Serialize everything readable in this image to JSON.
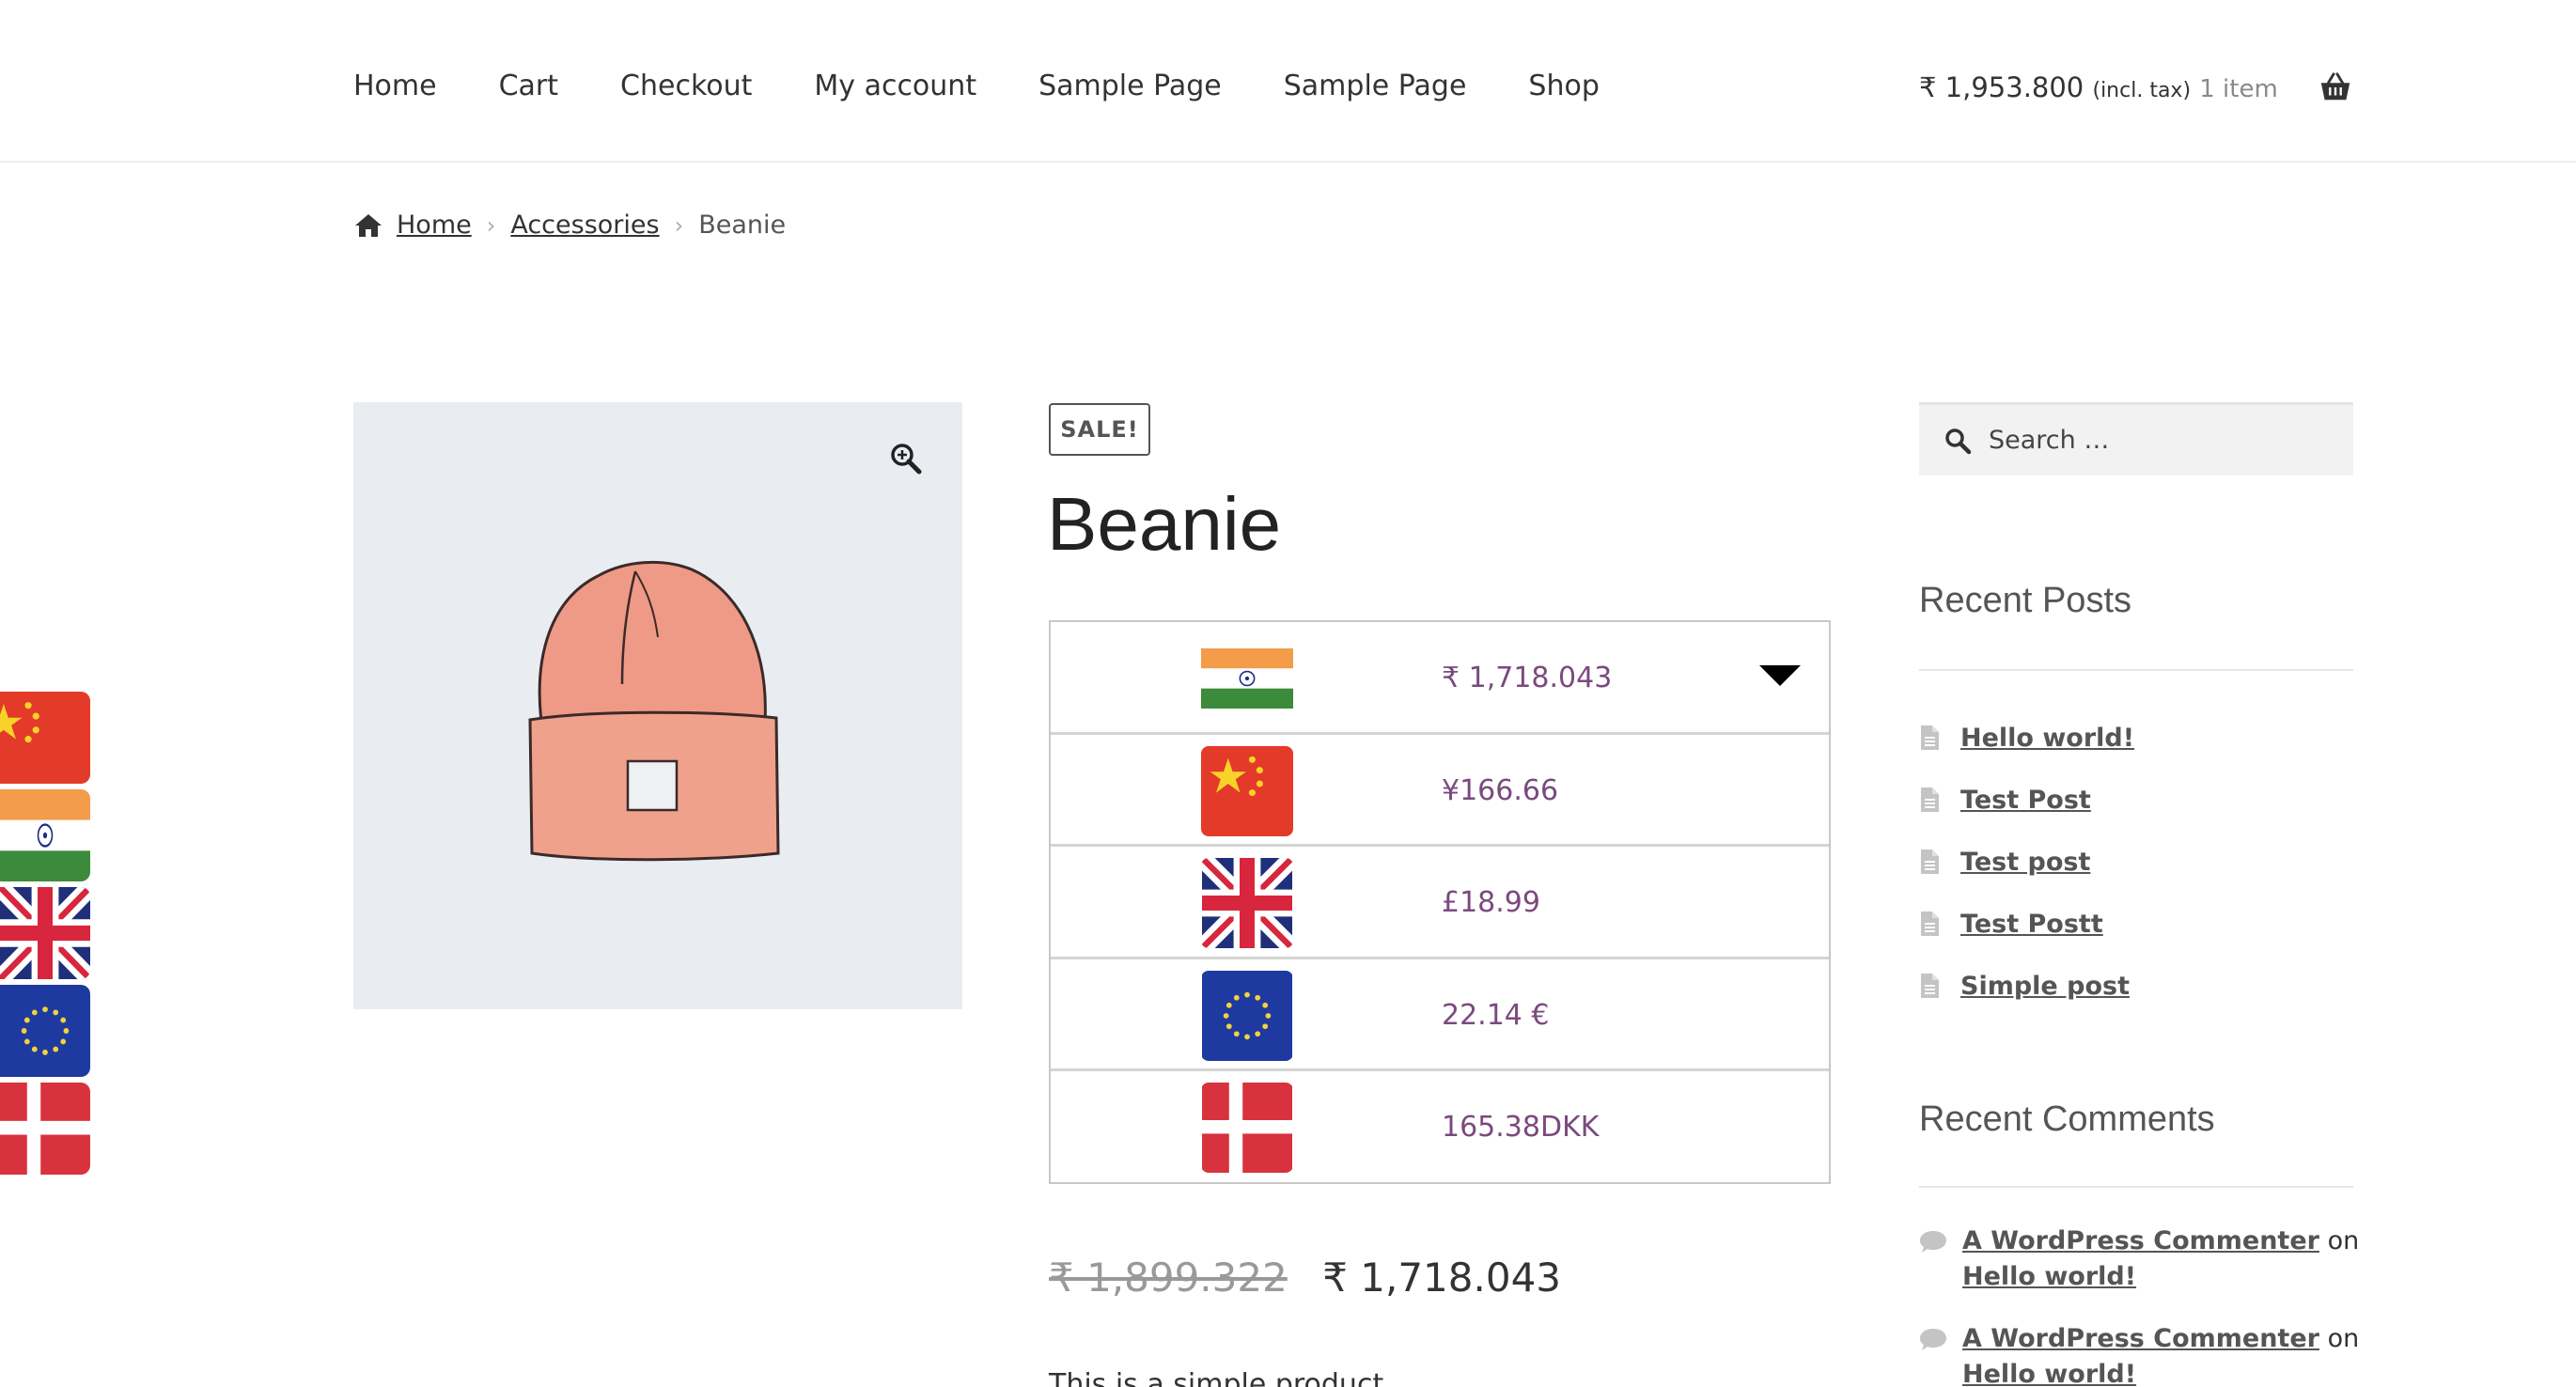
{
  "header": {
    "nav": [
      {
        "label": "Home"
      },
      {
        "label": "Cart"
      },
      {
        "label": "Checkout"
      },
      {
        "label": "My account"
      },
      {
        "label": "Sample Page"
      },
      {
        "label": "Sample Page"
      },
      {
        "label": "Shop"
      }
    ],
    "cart": {
      "amount": "₹ 1,953.800",
      "tax_note": "(incl. tax)",
      "count": "1 item",
      "icon": "basket-icon"
    }
  },
  "breadcrumb": {
    "icon": "home-icon",
    "items": [
      "Home",
      "Accessories",
      "Beanie"
    ]
  },
  "product": {
    "badge": "SALE!",
    "title": "Beanie",
    "image_icon": "zoom-icon",
    "currencies": [
      {
        "flag": "india-flag-icon",
        "price": "₹ 1,718.043",
        "selected": true
      },
      {
        "flag": "china-flag-icon",
        "price": "¥166.66"
      },
      {
        "flag": "uk-flag-icon",
        "price": "£18.99"
      },
      {
        "flag": "eu-flag-icon",
        "price": "22.14 €"
      },
      {
        "flag": "denmark-flag-icon",
        "price": "165.38DKK"
      }
    ],
    "price_old": "₹ 1,899.322",
    "price_new": "₹ 1,718.043",
    "description_fragment": "This is a simple product."
  },
  "sidebar": {
    "search_placeholder": "Search …",
    "recent_posts_title": "Recent Posts",
    "posts": [
      "Hello world!",
      "Test Post",
      "Test post",
      "Test Postt",
      "Simple post"
    ],
    "recent_comments_title": "Recent Comments",
    "comments": [
      {
        "author": "A WordPress Commenter",
        "on": "on",
        "post": "Hello world!"
      },
      {
        "author": "A WordPress Commenter",
        "on": "on",
        "post": "Hello world!"
      }
    ]
  },
  "floating_flags": [
    "china-flag-icon",
    "india-flag-icon",
    "uk-flag-icon",
    "eu-flag-icon",
    "denmark-flag-icon"
  ],
  "colors": {
    "price_purple": "#7a4a7e",
    "image_bg": "#e9edf2",
    "beanie": "#ef9a86"
  }
}
